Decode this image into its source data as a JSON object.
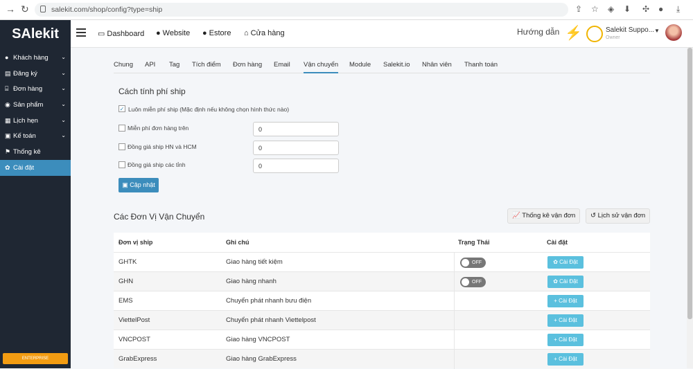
{
  "browser": {
    "url": "salekit.com/shop/config?type=ship"
  },
  "header": {
    "logo_prefix": "SA",
    "logo_suffix": "lekit",
    "nav": [
      "Dashboard",
      "Website",
      "Estore",
      "Cửa hàng"
    ],
    "help": "Hướng dẫn",
    "user_name": "Salekit Suppo...",
    "user_role": "Owner"
  },
  "sidebar": {
    "items": [
      {
        "label": "Khách hàng",
        "icon": "user-icon",
        "chev": "❯"
      },
      {
        "label": "Đăng ký",
        "icon": "list-icon",
        "chev": "❯"
      },
      {
        "label": "Đơn hàng",
        "icon": "cart-icon",
        "chev": "❯"
      },
      {
        "label": "Sản phẩm",
        "icon": "box-icon",
        "chev": "❯"
      },
      {
        "label": "Lịch hẹn",
        "icon": "calendar-icon",
        "chev": "❯"
      },
      {
        "label": "Kế toán",
        "icon": "calc-icon",
        "chev": "❯"
      },
      {
        "label": "Thống kê",
        "icon": "flag-icon",
        "chev": ""
      },
      {
        "label": "Cài đặt",
        "icon": "gear-icon",
        "chev": ""
      }
    ],
    "badge": "ENTERPRISE"
  },
  "tabs": [
    "Chung",
    "API",
    "Tag",
    "Tích điểm",
    "Đơn hàng",
    "Email",
    "Vận chuyển",
    "Module",
    "Salekit.io",
    "Nhân viên",
    "Thanh toán"
  ],
  "ship_fee": {
    "title": "Cách tính phí ship",
    "free_always": "Luôn miễn phí ship (Mặc định nếu không chọn hình thức nào)",
    "rows": [
      {
        "label": "Miễn phí đơn hàng trên",
        "value": "0"
      },
      {
        "label": "Đồng giá ship HN và HCM",
        "value": "0"
      },
      {
        "label": "Đồng giá ship các tỉnh",
        "value": "0"
      }
    ],
    "update_label": "Cập nhật"
  },
  "carriers": {
    "title": "Các Đơn Vị Vận Chuyển",
    "stats_btn": "Thống kê vận đơn",
    "history_btn": "Lịch sử vận đơn",
    "headers": [
      "Đơn vị ship",
      "Ghi chú",
      "Trạng Thái",
      "Cài đặt"
    ],
    "rows": [
      {
        "name": "GHTK",
        "note": "Giao hàng tiết kiệm",
        "status": "OFF",
        "btn": "✿ Cài Đặt"
      },
      {
        "name": "GHN",
        "note": "Giao hàng nhanh",
        "status": "OFF",
        "btn": "✿ Cài Đặt"
      },
      {
        "name": "EMS",
        "note": "Chuyển phát nhanh bưu điện",
        "status": "",
        "btn": "+ Cài Đặt"
      },
      {
        "name": "ViettelPost",
        "note": "Chuyển phát nhanh Viettelpost",
        "status": "",
        "btn": "+ Cài Đặt"
      },
      {
        "name": "VNCPOST",
        "note": "Giao hàng VNCPOST",
        "status": "",
        "btn": "+ Cài Đặt"
      },
      {
        "name": "GrabExpress",
        "note": "Giao hàng GrabExpress",
        "status": "",
        "btn": "+ Cài Đặt"
      }
    ]
  }
}
